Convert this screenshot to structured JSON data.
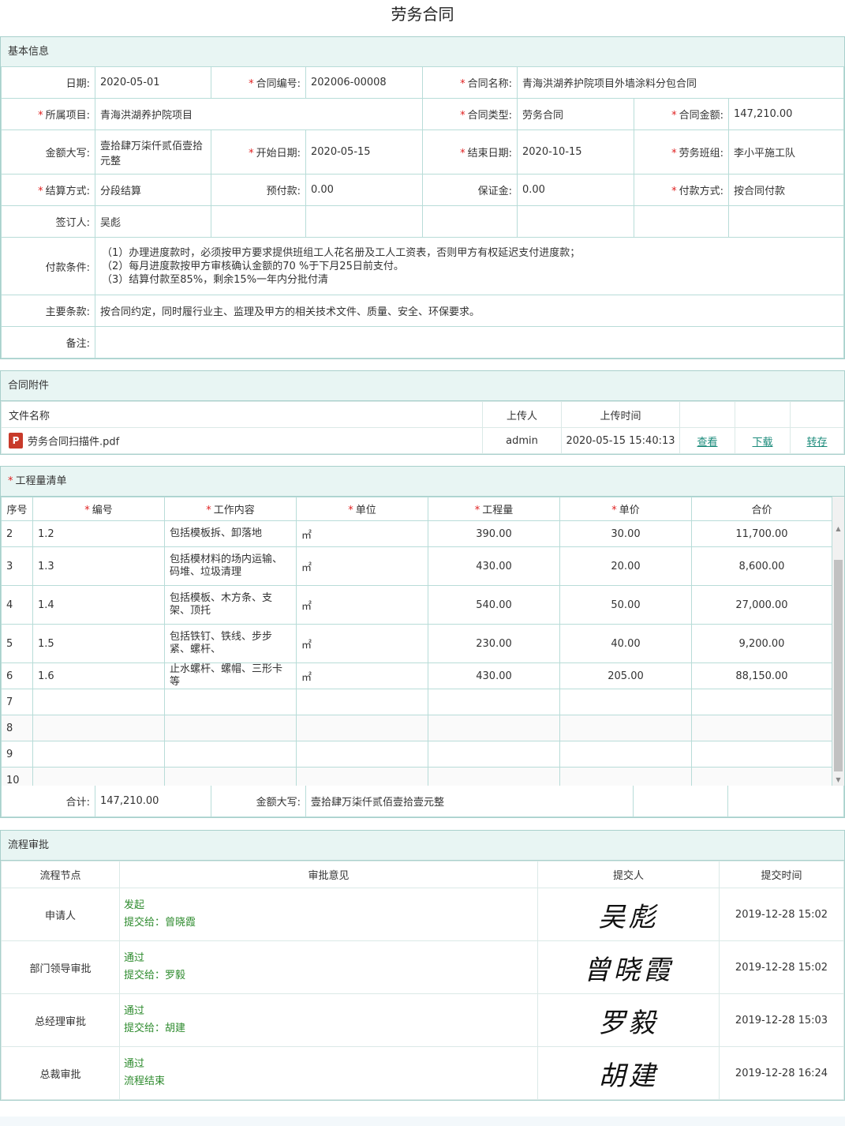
{
  "title": "劳务合同",
  "basic": {
    "header": "基本信息",
    "date_label": "日期:",
    "date": "2020-05-01",
    "code_label": "合同编号:",
    "code": "202006-00008",
    "name_label": "合同名称:",
    "name": "青海洪湖养护院项目外墙涂料分包合同",
    "project_label": "所属项目:",
    "project": "青海洪湖养护院项目",
    "type_label": "合同类型:",
    "type": "劳务合同",
    "amount_label": "合同金额:",
    "amount": "147,210.00",
    "upper_label": "金额大写:",
    "upper": "壹拾肆万柒仟贰佰壹拾元整",
    "start_label": "开始日期:",
    "start": "2020-05-15",
    "end_label": "结束日期:",
    "end": "2020-10-15",
    "team_label": "劳务班组:",
    "team": "李小平施工队",
    "settle_label": "结算方式:",
    "settle": "分段结算",
    "prepay_label": "预付款:",
    "prepay": "0.00",
    "deposit_label": "保证金:",
    "deposit": "0.00",
    "paymode_label": "付款方式:",
    "paymode": "按合同付款",
    "signer_label": "签订人:",
    "signer": "吴彪",
    "terms_label": "付款条件:",
    "terms": [
      "（1）办理进度款时，必须按甲方要求提供班组工人花名册及工人工资表，否则甲方有权延迟支付进度款；",
      "（2）每月进度款按甲方审核确认金额的70 %于下月25日前支付。",
      "（3）结算付款至85%，剩余15%一年内分批付清"
    ],
    "main_label": "主要条款:",
    "main": "按合同约定，同时履行业主、监理及甲方的相关技术文件、质量、安全、环保要求。",
    "remark_label": "备注:"
  },
  "attach": {
    "header": "合同附件",
    "col_name": "文件名称",
    "col_uploader": "上传人",
    "col_time": "上传时间",
    "file": "劳务合同扫描件.pdf",
    "uploader": "admin",
    "time": "2020-05-15 15:40:13",
    "view": "查看",
    "download": "下载",
    "transfer": "转存"
  },
  "qty": {
    "header": "工程量清单",
    "cols": [
      "序号",
      "编号",
      "工作内容",
      "单位",
      "工程量",
      "单价",
      "合价"
    ],
    "rows": [
      [
        "2",
        "1.2",
        "包括模板拆、卸落地",
        "㎡",
        "390.00",
        "30.00",
        "11,700.00"
      ],
      [
        "3",
        "1.3",
        "包括模材料的场内运输、码堆、垃圾清理",
        "㎡",
        "430.00",
        "20.00",
        "8,600.00"
      ],
      [
        "4",
        "1.4",
        "包括模板、木方条、支架、顶托",
        "㎡",
        "540.00",
        "50.00",
        "27,000.00"
      ],
      [
        "5",
        "1.5",
        "包括铁钉、铁线、步步紧、螺杆、",
        "㎡",
        "230.00",
        "40.00",
        "9,200.00"
      ],
      [
        "6",
        "1.6",
        "止水螺杆、螺帽、三形卡等",
        "㎡",
        "430.00",
        "205.00",
        "88,150.00"
      ],
      [
        "7",
        "",
        "",
        "",
        "",
        "",
        ""
      ],
      [
        "8",
        "",
        "",
        "",
        "",
        "",
        ""
      ],
      [
        "9",
        "",
        "",
        "",
        "",
        "",
        ""
      ],
      [
        "10",
        "",
        "",
        "",
        "",
        "",
        ""
      ]
    ],
    "total_label": "合计:",
    "total": "147,210.00",
    "upper_label": "金额大写:",
    "upper": "壹拾肆万柒仟贰佰壹拾壹元整"
  },
  "approve": {
    "header": "流程审批",
    "cols": [
      "流程节点",
      "审批意见",
      "提交人",
      "提交时间"
    ],
    "rows": [
      {
        "node": "申请人",
        "opinion": "发起",
        "next": "提交给：曾晓霞",
        "sig": "吴彪",
        "time": "2019-12-28 15:02"
      },
      {
        "node": "部门领导审批",
        "opinion": "通过",
        "next": "提交给：罗毅",
        "sig": "曾晓霞",
        "time": "2019-12-28 15:02"
      },
      {
        "node": "总经理审批",
        "opinion": "通过",
        "next": "提交给：胡建",
        "sig": "罗毅",
        "time": "2019-12-28 15:03"
      },
      {
        "node": "总裁审批",
        "opinion": "通过",
        "next": "流程结束",
        "sig": "胡建",
        "time": "2019-12-28 16:24"
      }
    ]
  },
  "colors": {
    "border": "#a9d0cc",
    "header_bg": "#e8f5f3",
    "link": "#1a8a7a",
    "green": "#2e8b2e",
    "required": "#e02020"
  }
}
